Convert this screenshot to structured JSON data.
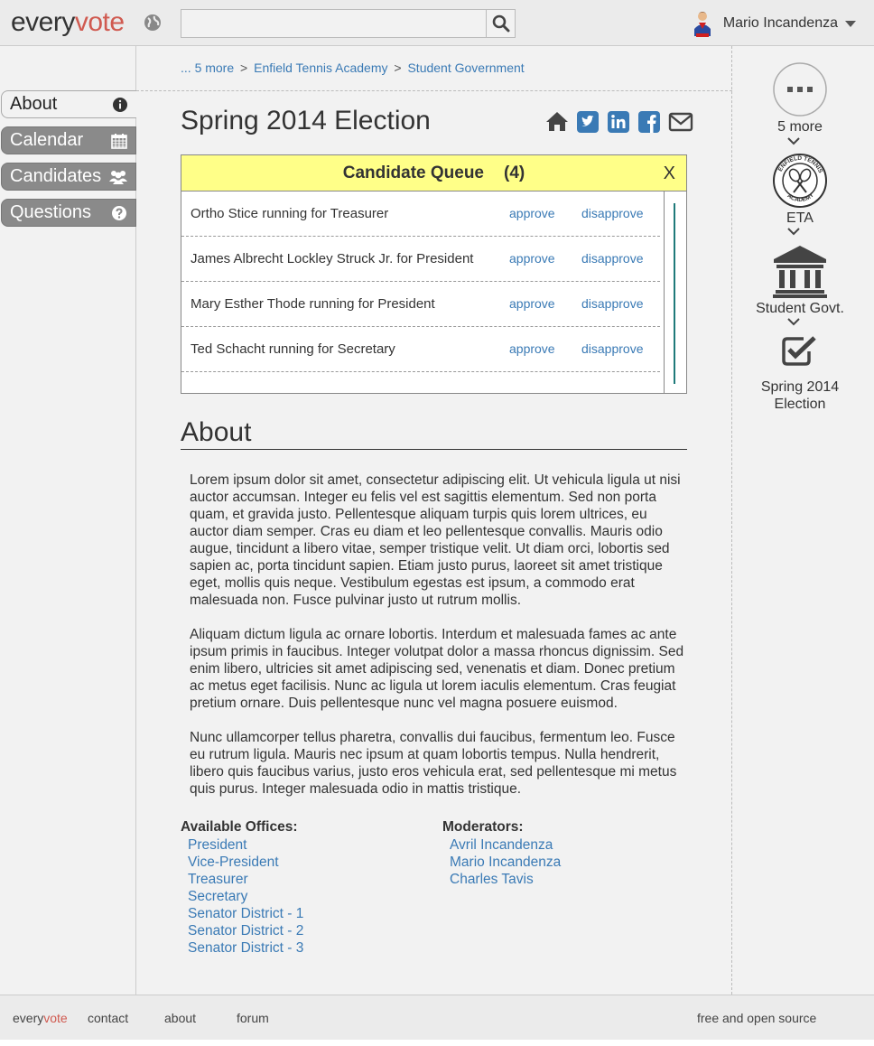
{
  "brand": {
    "part1": "every",
    "part2": "vote"
  },
  "search": {
    "placeholder": ""
  },
  "user": {
    "name": "Mario Incandenza"
  },
  "breadcrumb": {
    "prefix": "... ",
    "more": "5 more",
    "sep": ">",
    "item1": "Enfield Tennis Academy",
    "item2": "Student Government"
  },
  "sidebar": {
    "items": [
      {
        "label": "About",
        "icon": "info-icon"
      },
      {
        "label": "Calendar",
        "icon": "calendar-icon"
      },
      {
        "label": "Candidates",
        "icon": "users-icon"
      },
      {
        "label": "Questions",
        "icon": "question-icon"
      }
    ]
  },
  "page": {
    "title": "Spring 2014 Election"
  },
  "queue": {
    "title": "Candidate Queue",
    "count": "(4)",
    "close": "X",
    "approve_label": "approve",
    "disapprove_label": "disapprove",
    "rows": [
      {
        "name": "Ortho Stice running for Treasurer"
      },
      {
        "name": "James Albrecht Lockley Struck Jr. for President"
      },
      {
        "name": "Mary Esther Thode running for President"
      },
      {
        "name": "Ted Schacht running for Secretary"
      }
    ]
  },
  "about": {
    "title": "About",
    "paragraphs": [
      "Lorem ipsum dolor sit amet, consectetur adipiscing elit. Ut vehicula ligula ut nisi auctor accumsan. Integer eu felis vel est sagittis elementum. Sed non porta quam, et gravida justo. Pellentesque aliquam turpis quis lorem ultrices, eu auctor diam semper. Cras eu diam et leo pellentesque convallis. Mauris odio augue, tincidunt a libero vitae, semper tristique velit. Ut diam orci, lobortis sed sapien ac, porta tincidunt sapien. Etiam justo purus, laoreet sit amet tristique eget, mollis quis neque. Vestibulum egestas est ipsum, a commodo erat malesuada non. Fusce pulvinar justo ut rutrum mollis.",
      "Aliquam dictum ligula ac ornare lobortis. Interdum et malesuada fames ac ante ipsum primis in faucibus. Integer volutpat dolor a massa rhoncus dignissim. Sed enim libero, ultricies sit amet adipiscing sed, venenatis et diam. Donec pretium ac metus eget facilisis. Nunc ac ligula ut lorem iaculis elementum. Cras feugiat pretium ornare. Duis pellentesque nunc vel magna posuere euismod.",
      "Nunc ullamcorper tellus pharetra, convallis dui faucibus, fermentum leo. Fusce eu rutrum ligula. Mauris nec ipsum at quam lobortis tempus. Nulla hendrerit, libero quis faucibus varius, justo eros vehicula erat, sed pellentesque mi metus quis purus. Integer malesuada odio in mattis tristique."
    ]
  },
  "offices": {
    "title": "Available Offices:",
    "items": [
      "President",
      "Vice-President",
      "Treasurer",
      "Secretary",
      "Senator District - 1",
      "Senator District - 2",
      "Senator District - 3"
    ]
  },
  "moderators": {
    "title": "Moderators:",
    "items": [
      "Avril Incandenza",
      "Mario Incandenza",
      "Charles Tavis"
    ]
  },
  "right_nav": {
    "more_label": "5 more",
    "eta_label": "ETA",
    "student_govt_label": "Student Govt.",
    "election_label": "Spring 2014 Election",
    "eta_logo_text": "ENFIELD TENNIS ACADEMY"
  },
  "footer": {
    "brand1": "every",
    "brand2": "vote",
    "contact": "contact",
    "about": "about",
    "forum": "forum",
    "oss": "free and open source"
  },
  "colors": {
    "accent": "#d05a50",
    "link": "#3a7ab5",
    "queue_header": "#ffff88",
    "nav_inactive": "#8a8a8a"
  }
}
